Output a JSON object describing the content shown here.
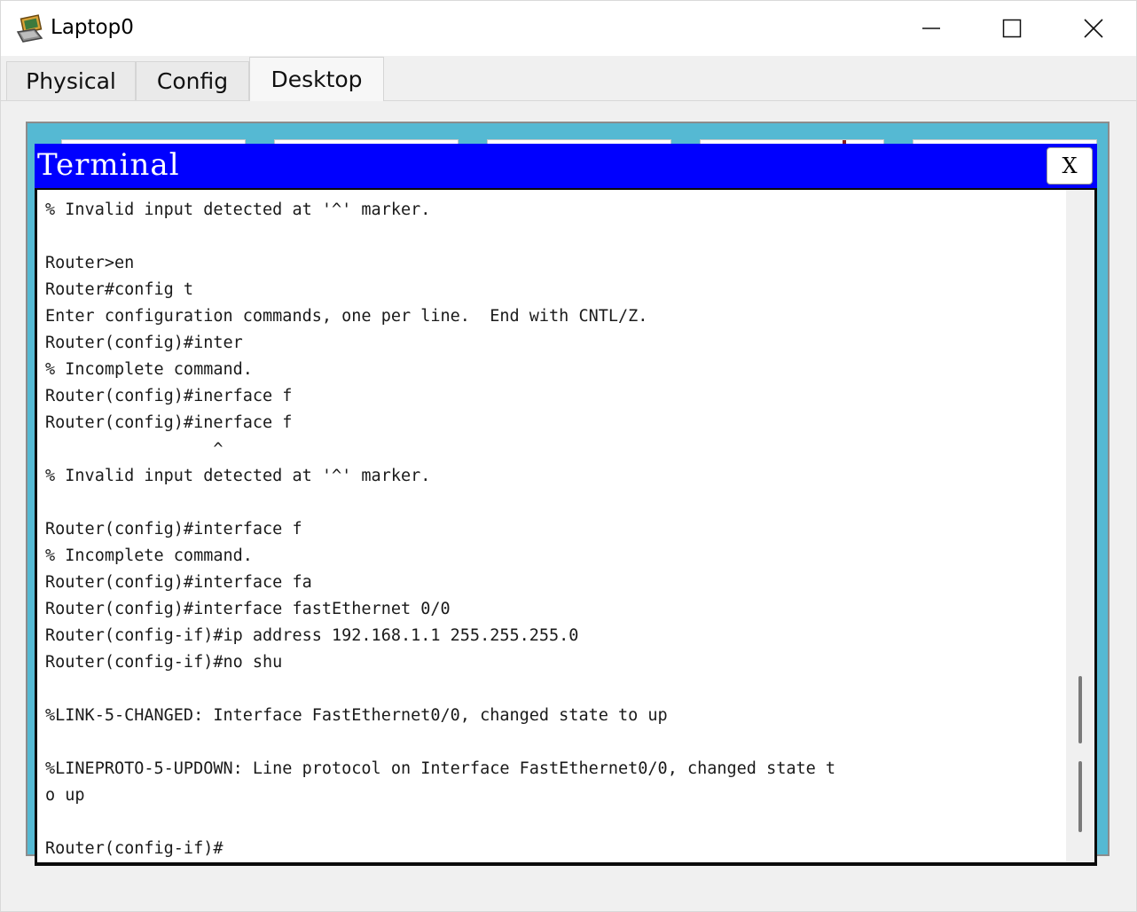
{
  "window": {
    "title": "Laptop0",
    "app_icon": "packet-tracer-laptop-icon",
    "controls": [
      "minimize-icon",
      "maximize-icon",
      "close-icon"
    ]
  },
  "tabs": [
    {
      "label": "Physical",
      "active": false
    },
    {
      "label": "Config",
      "active": false
    },
    {
      "label": "Desktop",
      "active": true
    }
  ],
  "terminal": {
    "title": "Terminal",
    "close_label": "X",
    "lines": [
      "% Invalid input detected at '^' marker.",
      "",
      "Router>en",
      "Router#config t",
      "Enter configuration commands, one per line.  End with CNTL/Z.",
      "Router(config)#inter",
      "% Incomplete command.",
      "Router(config)#inerface f",
      "Router(config)#inerface f",
      "                 ^",
      "% Invalid input detected at '^' marker.",
      "",
      "Router(config)#interface f",
      "% Incomplete command.",
      "Router(config)#interface fa",
      "Router(config)#interface fastEthernet 0/0",
      "Router(config-if)#ip address 192.168.1.1 255.255.255.0",
      "Router(config-if)#no shu",
      "",
      "%LINK-5-CHANGED: Interface FastEthernet0/0, changed state to up",
      "",
      "%LINEPROTO-5-UPDOWN: Line protocol on Interface FastEthernet0/0, changed state t",
      "o up",
      "",
      "Router(config-if)#"
    ]
  },
  "colors": {
    "terminal_titlebar": "#0000ff",
    "desktop_background": "#55b9d3",
    "terminal_text": "#1a1a1a"
  }
}
